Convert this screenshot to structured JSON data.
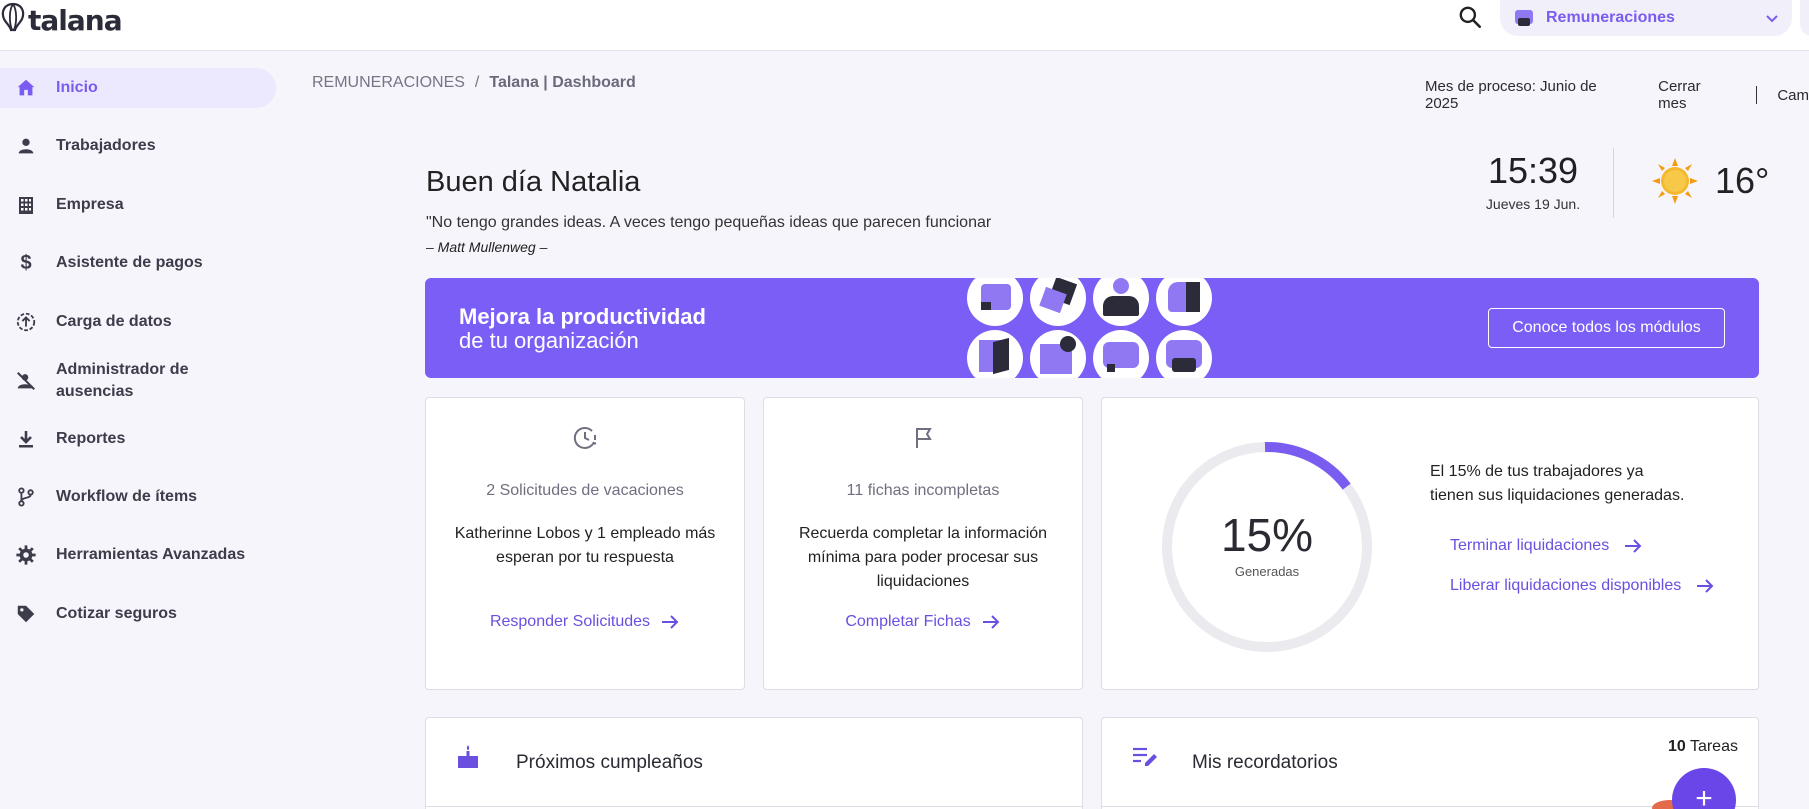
{
  "app": {
    "logo_text": "talana"
  },
  "topbar": {
    "module_label": "Remuneraciones"
  },
  "sidebar": {
    "items": [
      {
        "label": "Inicio",
        "icon": "home-icon",
        "active": true
      },
      {
        "label": "Trabajadores",
        "icon": "person-icon"
      },
      {
        "label": "Empresa",
        "icon": "building-icon"
      },
      {
        "label": "Asistente de pagos",
        "icon": "dollar-icon"
      },
      {
        "label": "Carga de datos",
        "icon": "upload-icon"
      },
      {
        "label": "Administrador de ausencias",
        "icon": "person-off-icon"
      },
      {
        "label": "Reportes",
        "icon": "download-icon"
      },
      {
        "label": "Workflow de ítems",
        "icon": "branch-icon"
      },
      {
        "label": "Herramientas Avanzadas",
        "icon": "gear-icon"
      },
      {
        "label": "Cotizar seguros",
        "icon": "tag-icon"
      }
    ]
  },
  "breadcrumb": {
    "section": "REMUNERACIONES",
    "separator": "/",
    "current": "Talana | Dashboard"
  },
  "process": {
    "month": "Mes de proceso: Junio de 2025",
    "close_month": "Cerrar mes",
    "truncated_action": "Cam"
  },
  "greeting": {
    "title": "Buen día Natalia",
    "quote": "\"No tengo grandes ideas. A veces tengo pequeñas ideas que parecen funcionar",
    "author": "– Matt Mullenweg –"
  },
  "clock": {
    "time": "15:39",
    "date": "Jueves 19 Jun."
  },
  "weather": {
    "temperature": "16°",
    "icon": "sun-icon"
  },
  "banner": {
    "line1": "Mejora la productividad",
    "line2": "de tu organización",
    "button": "Conoce todos los módulos",
    "color": "#7a5ef5"
  },
  "cards": {
    "vacations": {
      "title": "2 Solicitudes de vacaciones",
      "body": "Katherinne Lobos y 1 empleado más esperan por tu respuesta",
      "link": "Responder Solicitudes"
    },
    "records": {
      "title": "11 fichas incompletas",
      "body": "Recuerda completar la información mínima para poder procesar sus liquidaciones",
      "link": "Completar Fichas"
    },
    "settlements": {
      "percent_value": 15,
      "percent": "15%",
      "label": "Generadas",
      "text": "El 15% de tus trabajadores ya tienen sus liquidaciones generadas.",
      "link1": "Terminar liquidaciones",
      "link2": "Liberar liquidaciones disponibles"
    }
  },
  "birthdays": {
    "title": "Próximos cumpleaños"
  },
  "reminders": {
    "title": "Mis recordatorios",
    "count": "10",
    "count_label": "Tareas",
    "fab": "+"
  },
  "colors": {
    "accent": "#7b5cf0",
    "link": "#6b4fe0"
  }
}
